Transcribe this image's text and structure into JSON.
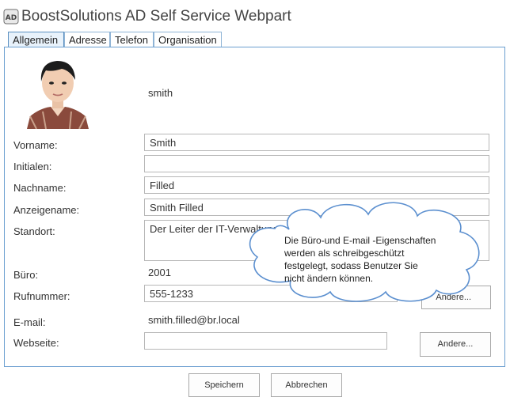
{
  "app": {
    "title": "BoostSolutions AD Self Service Webpart",
    "icon": "ad-app-icon",
    "icon_text": "AD"
  },
  "tabs": [
    {
      "label": "Allgemein",
      "active": true
    },
    {
      "label": "Adresse",
      "active": false
    },
    {
      "label": "Telefon",
      "active": false
    },
    {
      "label": "Organisation",
      "active": false
    }
  ],
  "profile": {
    "username": "smith",
    "photo": "user-avatar-photo"
  },
  "form": {
    "vorname": {
      "label": "Vorname:",
      "value": "Smith"
    },
    "initialen": {
      "label": "Initialen:",
      "value": ""
    },
    "nachname": {
      "label": "Nachname:",
      "value": "Filled"
    },
    "anzeigename": {
      "label": "Anzeigename:",
      "value": "Smith Filled"
    },
    "standort": {
      "label": "Standort:",
      "value": "Der Leiter der IT-Verwaltung"
    },
    "buero": {
      "label": "Büro:",
      "value": "2001"
    },
    "rufnummer": {
      "label": "Rufnummer:",
      "value": "555-1233",
      "button": "Andere..."
    },
    "email": {
      "label": "E-mail:",
      "value": "smith.filled@br.local"
    },
    "webseite": {
      "label": "Webseite:",
      "value": "",
      "button": "Andere..."
    }
  },
  "callout": {
    "line1": "Die Büro-und E-mail -Eigenschaften",
    "line2": "werden als schreibgeschützt",
    "line3": "festgelegt, sodass Benutzer Sie",
    "line4": "nicht ändern können."
  },
  "actions": {
    "save": "Speichern",
    "cancel": "Abbrechen"
  },
  "colors": {
    "accent": "#6b9fd0",
    "callout_fill": "#ffffff",
    "callout_border": "#5b8fcf"
  }
}
